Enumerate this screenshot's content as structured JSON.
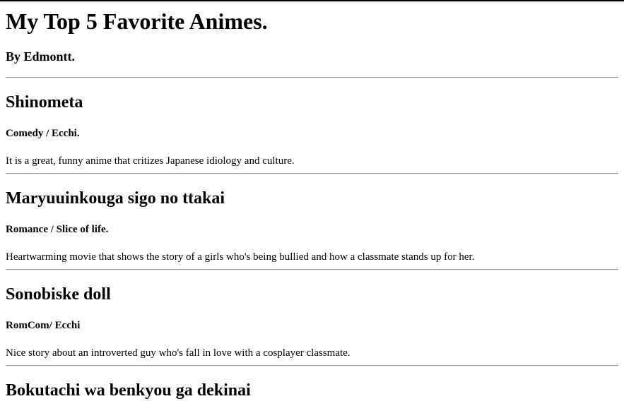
{
  "header": {
    "title": "My Top 5 Favorite Animes.",
    "byline": "By Edmontt."
  },
  "entries": [
    {
      "title": "Shinometa",
      "genre": "Comedy / Ecchi.",
      "description": "It is a great, funny anime that critizes Japanese idiology and culture."
    },
    {
      "title": "Maryuuinkouga sigo no ttakai",
      "genre": "Romance / Slice of life.",
      "description": "Heartwarming movie that shows the story of a girls who's being bullied and how a classmate stands up for her."
    },
    {
      "title": "Sonobiske doll",
      "genre": "RomCom/ Ecchi",
      "description": "Nice story about an introverted guy who's fall in love with a cosplayer classmate."
    },
    {
      "title": "Bokutachi wa benkyou ga dekinai"
    }
  ]
}
